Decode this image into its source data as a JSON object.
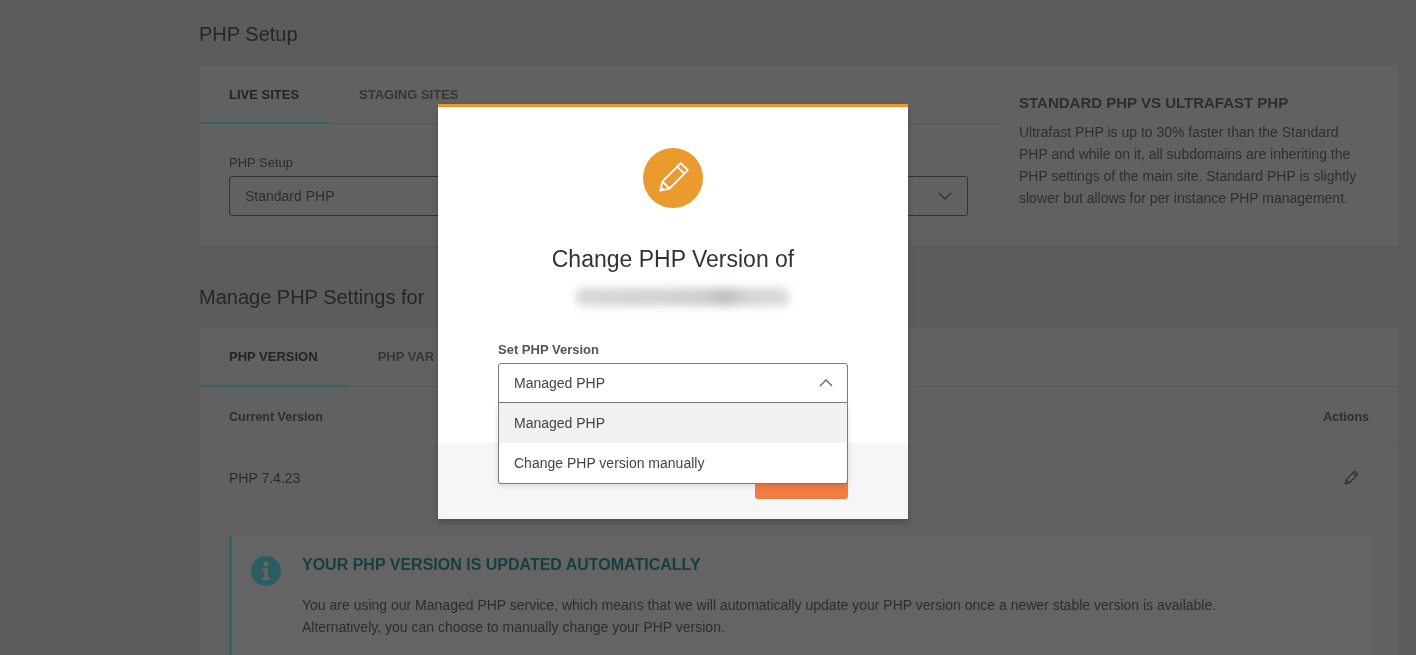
{
  "php_setup": {
    "heading": "PHP Setup",
    "tabs": [
      {
        "label": "LIVE SITES",
        "selected": true
      },
      {
        "label": "STAGING SITES",
        "selected": false
      }
    ],
    "field": {
      "label": "PHP Setup",
      "value": "Standard PHP"
    },
    "aside": {
      "title": "STANDARD PHP VS ULTRAFAST PHP",
      "text": "Ultrafast PHP is up to 30% faster than the Standard PHP and while on it, all subdomains are inheriting the PHP settings of the main site. Standard PHP is slightly slower but allows for per instance PHP management."
    }
  },
  "manage": {
    "heading": "Manage PHP Settings for",
    "tabs": [
      {
        "label": "PHP VERSION",
        "selected": true
      },
      {
        "label": "PHP VAR",
        "selected": false
      }
    ],
    "table": {
      "columns": [
        "Current Version",
        "Actions"
      ],
      "rows": [
        {
          "current_version": "PHP 7.4.23"
        }
      ]
    },
    "notice": {
      "title": "YOUR PHP VERSION IS UPDATED AUTOMATICALLY",
      "lines": [
        "You are using our Managed PHP service, which means that we will automatically update your PHP version once a newer stable version is available.",
        "Alternatively, you can choose to manually change your PHP version."
      ]
    }
  },
  "modal": {
    "title": "Change PHP Version of",
    "field": {
      "label": "Set PHP Version",
      "value": "Managed PHP",
      "expanded": true,
      "options": [
        {
          "label": "Managed PHP",
          "selected": true
        },
        {
          "label": "Change PHP version manually",
          "selected": false
        }
      ]
    }
  }
}
